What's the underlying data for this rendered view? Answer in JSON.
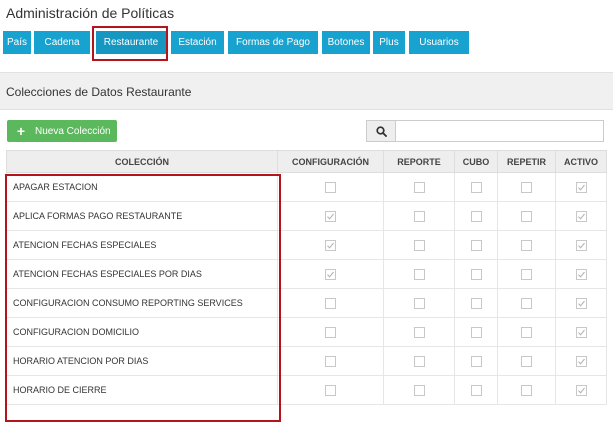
{
  "page": {
    "title": "Administración de Políticas"
  },
  "tabs": [
    {
      "label": "País",
      "active": false
    },
    {
      "label": "Cadena",
      "active": false
    },
    {
      "label": "Restaurante",
      "active": true
    },
    {
      "label": "Estación",
      "active": false
    },
    {
      "label": "Formas de Pago",
      "active": false
    },
    {
      "label": "Botones",
      "active": false
    },
    {
      "label": "Plus",
      "active": false
    },
    {
      "label": "Usuarios",
      "active": false
    }
  ],
  "section": {
    "title": "Colecciones de Datos Restaurante"
  },
  "toolbar": {
    "new_button_label": "Nueva Colección",
    "search_placeholder": "",
    "search_icon": "search-icon"
  },
  "table": {
    "columns": [
      "COLECCIÓN",
      "CONFIGURACIÓN",
      "REPORTE",
      "CUBO",
      "REPETIR",
      "ACTIVO"
    ],
    "rows": [
      {
        "name": "APAGAR ESTACION",
        "configuracion": false,
        "reporte": false,
        "cubo": false,
        "repetir": false,
        "activo": true
      },
      {
        "name": "APLICA FORMAS PAGO RESTAURANTE",
        "configuracion": true,
        "reporte": false,
        "cubo": false,
        "repetir": false,
        "activo": true
      },
      {
        "name": "ATENCION FECHAS ESPECIALES",
        "configuracion": true,
        "reporte": false,
        "cubo": false,
        "repetir": false,
        "activo": true
      },
      {
        "name": "ATENCION FECHAS ESPECIALES POR DIAS",
        "configuracion": true,
        "reporte": false,
        "cubo": false,
        "repetir": false,
        "activo": true
      },
      {
        "name": "CONFIGURACION CONSUMO REPORTING SERVICES",
        "configuracion": false,
        "reporte": false,
        "cubo": false,
        "repetir": false,
        "activo": true
      },
      {
        "name": "CONFIGURACION DOMICILIO",
        "configuracion": false,
        "reporte": false,
        "cubo": false,
        "repetir": false,
        "activo": true
      },
      {
        "name": "HORARIO ATENCION POR DIAS",
        "configuracion": false,
        "reporte": false,
        "cubo": false,
        "repetir": false,
        "activo": true
      },
      {
        "name": "HORARIO DE CIERRE",
        "configuracion": false,
        "reporte": false,
        "cubo": false,
        "repetir": false,
        "activo": true
      }
    ]
  },
  "colors": {
    "tab_bg": "#17a2cf",
    "button_green": "#5cb85c",
    "annotation_red": "#b4141c",
    "checkmark": "#b5b5b5"
  }
}
